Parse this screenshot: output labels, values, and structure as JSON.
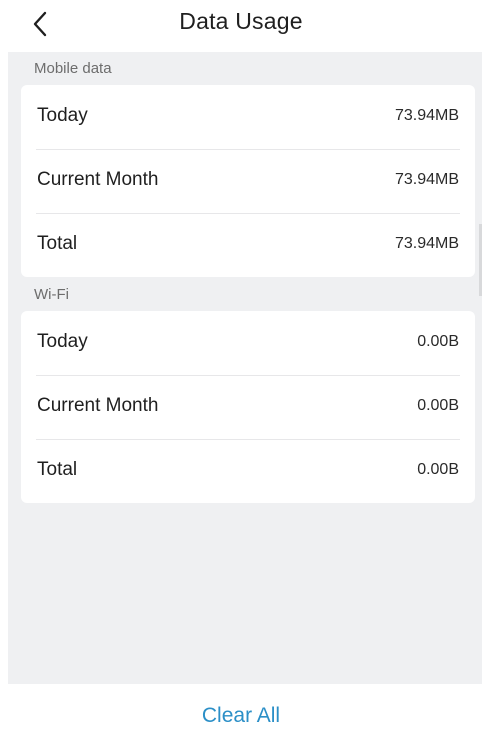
{
  "colors": {
    "accent": "#2b8fc7",
    "background": "#eff0f2",
    "card": "#ffffff"
  },
  "header": {
    "title": "Data Usage",
    "back_icon": "chevron-left-icon"
  },
  "mobile_data": {
    "label": "Mobile data",
    "rows": [
      {
        "label": "Today",
        "value": "73.94MB"
      },
      {
        "label": "Current Month",
        "value": "73.94MB"
      },
      {
        "label": "Total",
        "value": "73.94MB"
      }
    ]
  },
  "wifi": {
    "label": "Wi-Fi",
    "rows": [
      {
        "label": "Today",
        "value": "0.00B"
      },
      {
        "label": "Current Month",
        "value": "0.00B"
      },
      {
        "label": "Total",
        "value": "0.00B"
      }
    ]
  },
  "footer": {
    "clear_all_label": "Clear All"
  }
}
